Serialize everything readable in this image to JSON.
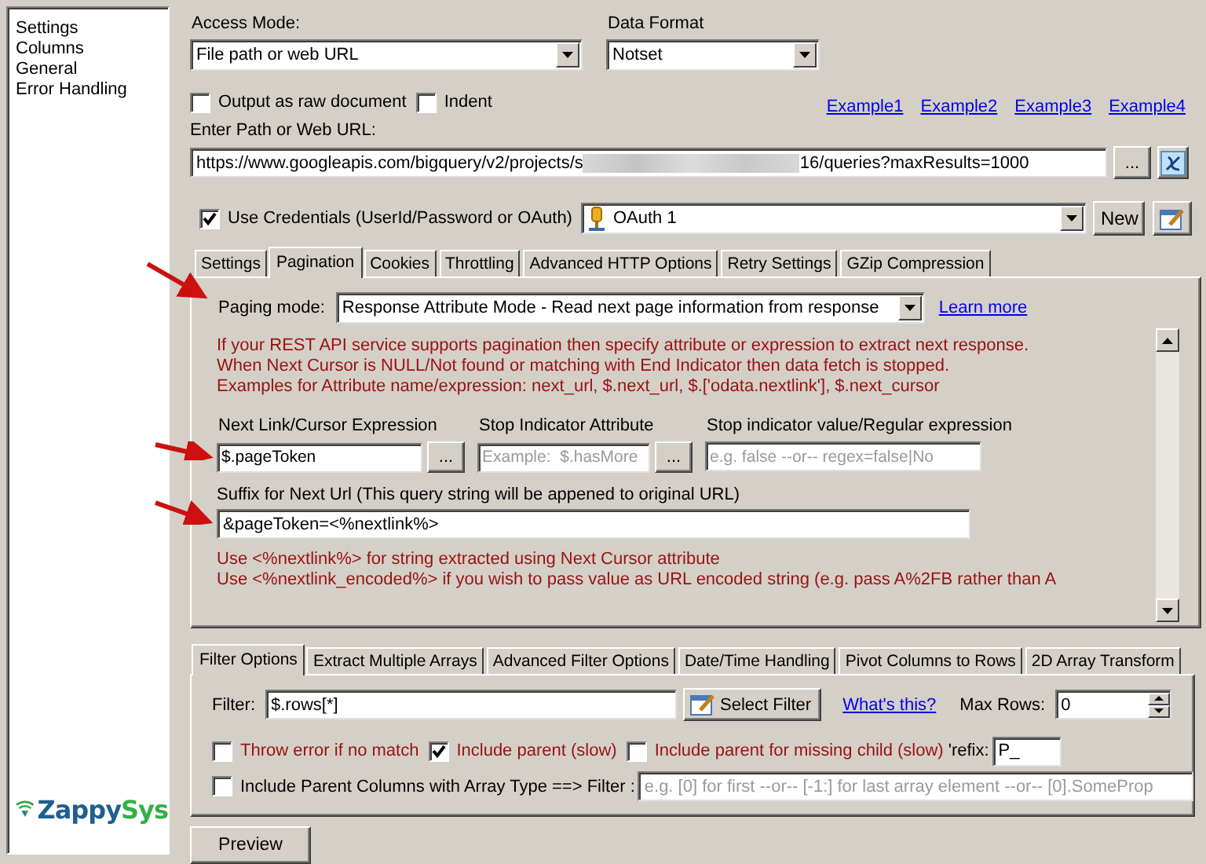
{
  "sidebar": {
    "items": [
      "Settings",
      "Columns",
      "General",
      "Error Handling"
    ]
  },
  "logo": {
    "text_1": "Zappy",
    "text_2": "Sys"
  },
  "access_mode": {
    "label": "Access Mode:",
    "value": "File path or web URL"
  },
  "data_format": {
    "label": "Data Format",
    "value": "Notset"
  },
  "options": [
    {
      "label": "Output as raw document",
      "checked": false
    },
    {
      "label": "Indent",
      "checked": false
    }
  ],
  "example_links": [
    "Example1",
    "Example2",
    "Example3",
    "Example4"
  ],
  "url": {
    "label": "Enter Path or Web URL:",
    "value_start": "https://www.googleapis.com/bigquery/v2/projects/s",
    "value_end": "16/queries?maxResults=1000",
    "redacted": true,
    "browse_button": "..."
  },
  "credentials": {
    "label": "Use Credentials (UserId/Password or OAuth)",
    "checked": true,
    "connection": "OAuth 1",
    "new_button": "New"
  },
  "tabs": [
    {
      "label": "Settings",
      "selected": false
    },
    {
      "label": "Pagination",
      "selected": true
    },
    {
      "label": "Cookies",
      "selected": false
    },
    {
      "label": "Throttling",
      "selected": false
    },
    {
      "label": "Advanced HTTP Options",
      "selected": false
    },
    {
      "label": "Retry Settings",
      "selected": false
    },
    {
      "label": "GZip Compression",
      "selected": false
    }
  ],
  "paging_mode": {
    "label": "Paging mode:",
    "value": "Response Attribute Mode - Read next page information from response",
    "link": "Learn more"
  },
  "help_lines": [
    "If your REST API service supports pagination then specify attribute or expression to extract next response.",
    "When Next Cursor is NULL/Not found or matching with End Indicator then data fetch is stopped.",
    "Examples for Attribute name/expression:  next_url, $.next_url,  $.['odata.nextlink'], $.next_cursor"
  ],
  "fields": [
    {
      "label": "Next Link/Cursor Expression",
      "value": "$.pageToken",
      "browse": "..."
    },
    {
      "label": "Stop Indicator Attribute",
      "placeholder": "Example:  $.hasMore",
      "browse": "..."
    },
    {
      "label": "Stop indicator value/Regular expression",
      "placeholder": "e.g. false --or-- regex=false|No"
    }
  ],
  "suffix": {
    "label": "Suffix for Next Url  (This query string will be appened to original URL)",
    "value": "&pageToken=<%nextlink%>"
  },
  "suffix_help": [
    "Use <%nextlink%> for string extracted using Next Cursor attribute",
    "Use <%nextlink_encoded%> if you wish to pass value as URL encoded string (e.g. pass A%2FB rather than A"
  ],
  "filter_tabs": [
    {
      "label": "Filter Options",
      "selected": true
    },
    {
      "label": "Extract Multiple Arrays",
      "selected": false
    },
    {
      "label": "Advanced Filter Options",
      "selected": false
    },
    {
      "label": "Date/Time Handling",
      "selected": false
    },
    {
      "label": "Pivot Columns to Rows",
      "selected": false
    },
    {
      "label": "2D Array Transform",
      "selected": false
    }
  ],
  "filter": {
    "label": "Filter:",
    "value": "$.rows[*]",
    "button": "Select Filter",
    "link": "What's this?",
    "max_rows_label": "Max Rows:",
    "max_rows": "0"
  },
  "filter_options": [
    {
      "label": "Throw error if no match",
      "checked": false
    },
    {
      "label": "Include parent (slow)",
      "checked": true
    },
    {
      "label": "Include parent for missing child (slow)",
      "checked": false
    }
  ],
  "prefix": {
    "label": "'refix:",
    "value": "P_"
  },
  "array_filter": {
    "label": "Include Parent Columns with Array Type ==> Filter :",
    "checked": false,
    "placeholder": "e.g. [0] for first --or-- [-1:] for last array element --or-- [0].SomeProp"
  },
  "preview_button": "Preview"
}
